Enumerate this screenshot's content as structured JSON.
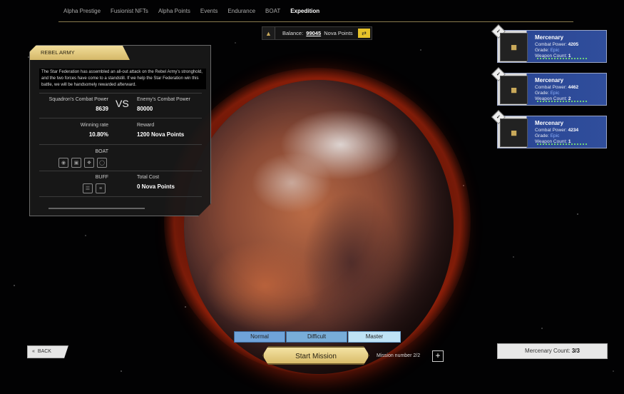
{
  "nav": {
    "tabs": [
      "Alpha Prestige",
      "Fusionist NFTs",
      "Alpha Points",
      "Events",
      "Endurance",
      "BOAT",
      "Expedition"
    ]
  },
  "balance": {
    "label": "Balance:",
    "value": "99045",
    "unit": "Nova Points"
  },
  "mission": {
    "title": "REBEL ARMY",
    "description": "The Star Federation has assembled an all-out attack on the Rebel Army's stronghold, and the two forces have come to a standstill. If we help the Star Federation win this battle, we will be handsomely rewarded afterward.",
    "squad_label": "Squadron's Combat Power",
    "squad_value": "8639",
    "vs": "VS",
    "enemy_label": "Enemy's Combat Power",
    "enemy_value": "80000",
    "win_label": "Winning rate",
    "win_value": "10.80%",
    "reward_label": "Reward",
    "reward_value": "1200 Nova Points",
    "boat_label": "BOAT",
    "buff_label": "BUFF",
    "cost_label": "Total Cost",
    "cost_value": "0 Nova Points"
  },
  "mercenaries": [
    {
      "name": "Mercenary",
      "power_label": "Combat Power:",
      "power": "4205",
      "grade_label": "Grade:",
      "grade": "Epic",
      "weapon_label": "Weapon Count:",
      "weapons": "1"
    },
    {
      "name": "Mercenary",
      "power_label": "Combat Power:",
      "power": "4462",
      "grade_label": "Grade:",
      "grade": "Epic",
      "weapon_label": "Weapon Count:",
      "weapons": "2"
    },
    {
      "name": "Mercenary",
      "power_label": "Combat Power:",
      "power": "4234",
      "grade_label": "Grade:",
      "grade": "Epic",
      "weapon_label": "Weapon Count:",
      "weapons": "1"
    }
  ],
  "difficulty": {
    "normal": "Normal",
    "difficult": "Difficult",
    "master": "Master",
    "selected": "Master"
  },
  "actions": {
    "start": "Start Mission",
    "mission_number": "Mission number 2/2",
    "plus": "+",
    "back": "BACK",
    "merc_count_label": "Mercenary Count:",
    "merc_count_value": "3/3"
  },
  "icons": {
    "balance": "alpha-logo-icon",
    "swap": "swap-icon",
    "check": "check-icon",
    "boat": [
      "boat-slot-1-icon",
      "boat-slot-2-icon",
      "boat-slot-3-icon",
      "boat-slot-4-icon"
    ],
    "buff": [
      "buff-1-icon",
      "buff-2-icon"
    ]
  }
}
